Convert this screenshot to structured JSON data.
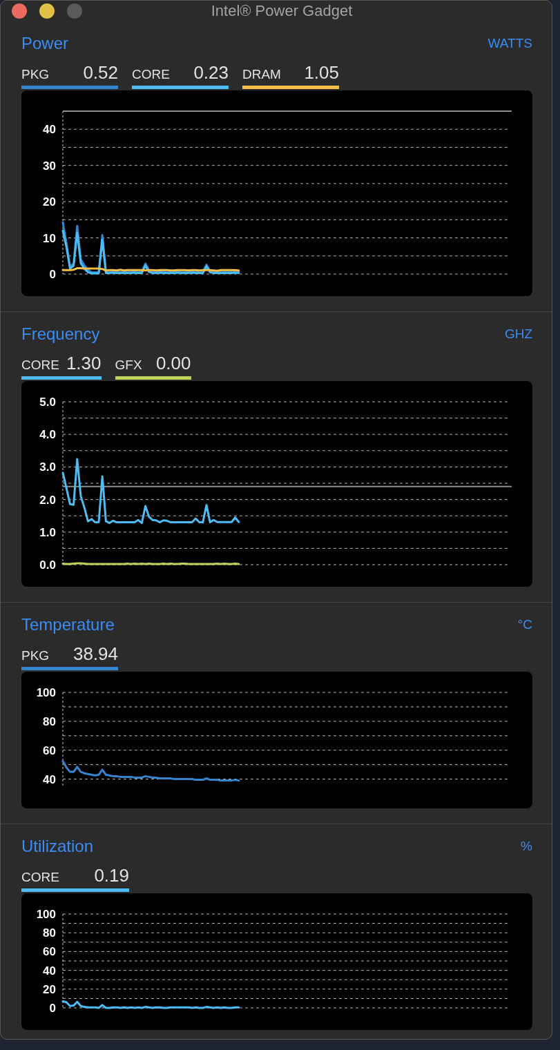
{
  "window": {
    "title": "Intel® Power Gadget",
    "controls": [
      {
        "kind": "close",
        "disabled": false
      },
      {
        "kind": "minimize",
        "disabled": false
      },
      {
        "kind": "zoom",
        "disabled": true
      }
    ]
  },
  "sections": [
    {
      "title": "Power",
      "unit": "WATTS",
      "readings": [
        {
          "value": "0.52"
        },
        {
          "value": "0.23"
        },
        {
          "value": "1.05"
        }
      ],
      "chart_data": {
        "type": "line",
        "grid": true,
        "ylim": [
          0,
          45
        ],
        "yticks": [
          0,
          10,
          20,
          30,
          40
        ],
        "ref_lines": [
          {
            "axis": "y",
            "value": 45
          }
        ],
        "series": [
          {
            "name": "PKG",
            "color": "#3484cf",
            "values": [
              14.3,
              8.5,
              2.1,
              2.9,
              13.3,
              4,
              2.4,
              1.1,
              0.5,
              0.5,
              0.5,
              10.8,
              0.6,
              0.6,
              0.7,
              0.6,
              0.6,
              0.6,
              0.6,
              0.6,
              0.7,
              0.6,
              0.6,
              2.9,
              1,
              0.6,
              0.6,
              0.7,
              0.6,
              0.6,
              0.6,
              0.6,
              0.7,
              0.6,
              0.6,
              0.6,
              0.7,
              0.6,
              0.6,
              0.6,
              2.6,
              0.8,
              0.6,
              0.6,
              0.6,
              0.6,
              0.6,
              0.6,
              0.7,
              0.6,
              null,
              null,
              null,
              null,
              null,
              null,
              null,
              null,
              null,
              null,
              null,
              null,
              null,
              null,
              null,
              null,
              null,
              null,
              null,
              null,
              null,
              null,
              null,
              null,
              null,
              null,
              null,
              null,
              null,
              null,
              null,
              null,
              null,
              null,
              null,
              null,
              null,
              null,
              null,
              null,
              null,
              null,
              null,
              null,
              null,
              null,
              null,
              null,
              null,
              null,
              null,
              null,
              null,
              null,
              null,
              null,
              null,
              null,
              null,
              null,
              null,
              null,
              null,
              null,
              null,
              null,
              null,
              null,
              null,
              null,
              null,
              null,
              null,
              null,
              null,
              null
            ]
          },
          {
            "name": "CORE",
            "color": "#4cbcf2",
            "values": [
              12,
              7.5,
              1.5,
              2.3,
              11.4,
              3,
              1.5,
              0.5,
              0.2,
              0.2,
              0.2,
              9.5,
              0.3,
              0.3,
              0.4,
              0.3,
              0.3,
              0.3,
              0.3,
              0.3,
              0.4,
              0.3,
              0.3,
              2.3,
              0.6,
              0.3,
              0.3,
              0.4,
              0.3,
              0.3,
              0.3,
              0.3,
              0.4,
              0.3,
              0.3,
              0.3,
              0.4,
              0.3,
              0.3,
              0.3,
              2.1,
              0.5,
              0.3,
              0.3,
              0.3,
              0.3,
              0.3,
              0.3,
              0.4,
              0.3,
              null,
              null,
              null,
              null,
              null,
              null,
              null,
              null,
              null,
              null,
              null,
              null,
              null,
              null,
              null,
              null,
              null,
              null,
              null,
              null,
              null,
              null,
              null,
              null,
              null,
              null,
              null,
              null,
              null,
              null,
              null,
              null,
              null,
              null,
              null,
              null,
              null,
              null,
              null,
              null,
              null,
              null,
              null,
              null,
              null,
              null,
              null,
              null,
              null,
              null,
              null,
              null,
              null,
              null,
              null,
              null,
              null,
              null,
              null,
              null,
              null,
              null,
              null,
              null,
              null,
              null,
              null,
              null,
              null,
              null,
              null,
              null,
              null,
              null,
              null,
              null
            ]
          },
          {
            "name": "DRAM",
            "color": "#f5bf45",
            "values": [
              1.1,
              1.1,
              1.1,
              1.2,
              1.6,
              1.6,
              1.5,
              1.5,
              1.5,
              1.5,
              1.5,
              1.4,
              1,
              1.1,
              1.1,
              1,
              1.2,
              1,
              1.1,
              1.1,
              1.1,
              1.1,
              1.1,
              1,
              1.1,
              1.1,
              1,
              1.1,
              1.1,
              1.1,
              1,
              1,
              1.1,
              1.1,
              1.1,
              1,
              1.1,
              1.1,
              1,
              1.1,
              1.1,
              1.1,
              1,
              0.9,
              1.1,
              1.1,
              1.1,
              1.1,
              1.1,
              1,
              null,
              null,
              null,
              null,
              null,
              null,
              null,
              null,
              null,
              null,
              null,
              null,
              null,
              null,
              null,
              null,
              null,
              null,
              null,
              null,
              null,
              null,
              null,
              null,
              null,
              null,
              null,
              null,
              null,
              null,
              null,
              null,
              null,
              null,
              null,
              null,
              null,
              null,
              null,
              null,
              null,
              null,
              null,
              null,
              null,
              null,
              null,
              null,
              null,
              null,
              null,
              null,
              null,
              null,
              null,
              null,
              null,
              null,
              null,
              null,
              null,
              null,
              null,
              null,
              null,
              null,
              null,
              null,
              null,
              null,
              null,
              null,
              null,
              null,
              null,
              null
            ]
          }
        ]
      }
    },
    {
      "title": "Frequency",
      "unit": "GHZ",
      "readings": [
        {
          "value": "1.30"
        },
        {
          "value": "0.00"
        }
      ],
      "chart_data": {
        "type": "line",
        "grid": true,
        "ylim": [
          0,
          5
        ],
        "yticks": [
          {
            "value": 0,
            "label": "0.0"
          },
          {
            "value": 1,
            "label": "1.0"
          },
          {
            "value": 2,
            "label": "2.0"
          },
          {
            "value": 3,
            "label": "3.0"
          },
          {
            "value": 4,
            "label": "4.0"
          },
          {
            "value": 5,
            "label": "5.0"
          }
        ],
        "ref_lines": [
          {
            "axis": "y",
            "value": 2.4
          }
        ],
        "series": [
          {
            "name": "CORE",
            "color": "#4cbcf2",
            "values": [
              2.82,
              2.35,
              1.86,
              1.84,
              3.24,
              2.1,
              1.75,
              1.33,
              1.4,
              1.3,
              1.3,
              2.71,
              1.33,
              1.28,
              1.35,
              1.3,
              1.3,
              1.3,
              1.3,
              1.3,
              1.3,
              1.37,
              1.28,
              1.8,
              1.47,
              1.37,
              1.36,
              1.3,
              1.36,
              1.35,
              1.3,
              1.3,
              1.3,
              1.3,
              1.3,
              1.3,
              1.3,
              1.42,
              1.3,
              1.3,
              1.83,
              1.3,
              1.37,
              1.31,
              1.31,
              1.31,
              1.31,
              1.31,
              1.45,
              1.31,
              null,
              null,
              null,
              null,
              null,
              null,
              null,
              null,
              null,
              null,
              null,
              null,
              null,
              null,
              null,
              null,
              null,
              null,
              null,
              null,
              null,
              null,
              null,
              null,
              null,
              null,
              null,
              null,
              null,
              null,
              null,
              null,
              null,
              null,
              null,
              null,
              null,
              null,
              null,
              null,
              null,
              null,
              null,
              null,
              null,
              null,
              null,
              null,
              null,
              null,
              null,
              null,
              null,
              null,
              null,
              null,
              null,
              null,
              null,
              null,
              null,
              null,
              null,
              null,
              null,
              null,
              null,
              null,
              null,
              null,
              null,
              null,
              null,
              null,
              null,
              null
            ]
          },
          {
            "name": "GFX",
            "color": "#bfd35a",
            "values": [
              0.03,
              0.02,
              0.02,
              0.03,
              0.04,
              0.04,
              0.03,
              0.02,
              0.02,
              0.02,
              0.02,
              0.02,
              0.02,
              0.02,
              0.02,
              0.02,
              0.02,
              0.02,
              0.03,
              0.02,
              0.03,
              0.02,
              0.03,
              0.02,
              0.03,
              0.02,
              0.02,
              0.02,
              0.03,
              0.02,
              0.03,
              0.02,
              0.02,
              0.03,
              0.03,
              0.02,
              0.02,
              0.02,
              0.02,
              0.02,
              0.02,
              0.02,
              0.02,
              0.03,
              0.02,
              0.03,
              0.02,
              0.02,
              0.03,
              0.02,
              null,
              null,
              null,
              null,
              null,
              null,
              null,
              null,
              null,
              null,
              null,
              null,
              null,
              null,
              null,
              null,
              null,
              null,
              null,
              null,
              null,
              null,
              null,
              null,
              null,
              null,
              null,
              null,
              null,
              null,
              null,
              null,
              null,
              null,
              null,
              null,
              null,
              null,
              null,
              null,
              null,
              null,
              null,
              null,
              null,
              null,
              null,
              null,
              null,
              null,
              null,
              null,
              null,
              null,
              null,
              null,
              null,
              null,
              null,
              null,
              null,
              null,
              null,
              null,
              null,
              null,
              null,
              null,
              null,
              null,
              null,
              null,
              null,
              null,
              null,
              null
            ]
          }
        ]
      }
    },
    {
      "title": "Temperature",
      "unit": "°C",
      "readings": [
        {
          "value": "38.94"
        }
      ],
      "chart_data": {
        "type": "line",
        "grid": true,
        "ylim": [
          35,
          100
        ],
        "yticks": [
          40,
          60,
          80,
          100
        ],
        "series": [
          {
            "name": "PKG",
            "color": "#3484cf",
            "values": [
              52.5,
              48,
              45,
              45,
              48.5,
              45,
              44,
              43.5,
              43,
              42.5,
              43,
              46.5,
              43,
              42.5,
              42,
              42,
              41.5,
              41.5,
              41.5,
              41.5,
              41,
              41,
              41,
              42,
              41.5,
              41,
              41,
              40.5,
              40.5,
              40.5,
              40.5,
              40,
              40,
              40,
              40,
              40,
              40,
              39.5,
              39.5,
              39.5,
              40.5,
              39.5,
              39.5,
              39.5,
              39,
              39,
              39,
              39,
              39.5,
              39,
              null,
              null,
              null,
              null,
              null,
              null,
              null,
              null,
              null,
              null,
              null,
              null,
              null,
              null,
              null,
              null,
              null,
              null,
              null,
              null,
              null,
              null,
              null,
              null,
              null,
              null,
              null,
              null,
              null,
              null,
              null,
              null,
              null,
              null,
              null,
              null,
              null,
              null,
              null,
              null,
              null,
              null,
              null,
              null,
              null,
              null,
              null,
              null,
              null,
              null,
              null,
              null,
              null,
              null,
              null,
              null,
              null,
              null,
              null,
              null,
              null,
              null,
              null,
              null,
              null,
              null,
              null,
              null,
              null,
              null,
              null,
              null,
              null,
              null,
              null,
              null
            ]
          }
        ]
      }
    },
    {
      "title": "Utilization",
      "unit": "%",
      "readings": [
        {
          "value": "0.19"
        }
      ],
      "chart_data": {
        "type": "line",
        "grid": true,
        "ylim": [
          0,
          100
        ],
        "yticks": [
          0,
          20,
          40,
          60,
          80,
          100
        ],
        "series": [
          {
            "name": "CORE",
            "color": "#4cbcf2",
            "values": [
              7,
              6,
              2,
              2.5,
              6.5,
              2,
              1,
              0.5,
              0.5,
              0.5,
              0,
              3,
              0,
              0,
              0.5,
              0.5,
              0,
              0.5,
              0,
              0.5,
              0,
              0.5,
              0,
              1,
              0.5,
              0,
              0.5,
              0.5,
              0,
              0,
              0.5,
              0.5,
              0.5,
              0.5,
              0.5,
              0.5,
              0,
              0.5,
              0,
              0,
              1,
              0.5,
              0,
              0.5,
              0,
              0.5,
              0,
              0,
              0.5,
              0.5,
              null,
              null,
              null,
              null,
              null,
              null,
              null,
              null,
              null,
              null,
              null,
              null,
              null,
              null,
              null,
              null,
              null,
              null,
              null,
              null,
              null,
              null,
              null,
              null,
              null,
              null,
              null,
              null,
              null,
              null,
              null,
              null,
              null,
              null,
              null,
              null,
              null,
              null,
              null,
              null,
              null,
              null,
              null,
              null,
              null,
              null,
              null,
              null,
              null,
              null,
              null,
              null,
              null,
              null,
              null,
              null,
              null,
              null,
              null,
              null,
              null,
              null,
              null,
              null,
              null,
              null,
              null,
              null,
              null,
              null,
              null,
              null,
              null,
              null,
              null,
              null
            ]
          }
        ]
      }
    }
  ]
}
